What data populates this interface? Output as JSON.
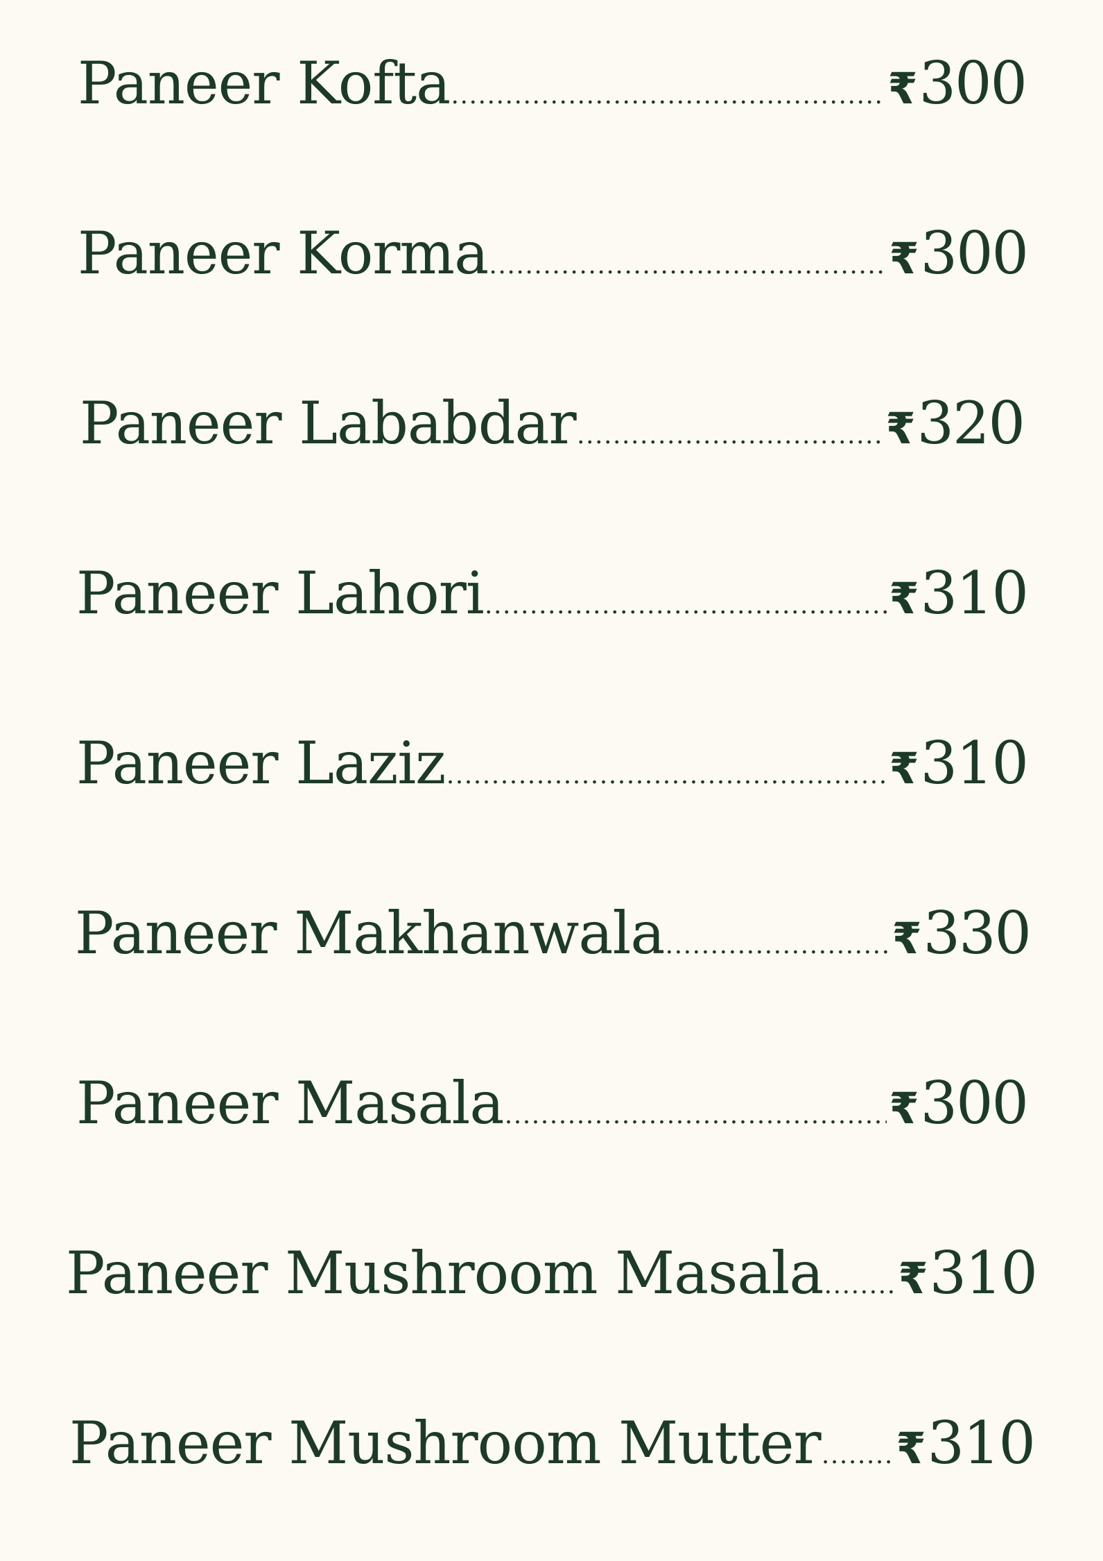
{
  "currency_symbol": "₹",
  "colors": {
    "background": "#fdf9f3",
    "text": "#1c3a28"
  },
  "menu": {
    "items": [
      {
        "name": "Paneer Kofta",
        "price": "300"
      },
      {
        "name": "Paneer Korma",
        "price": "300"
      },
      {
        "name": "Paneer Lababdar",
        "price": "320"
      },
      {
        "name": "Paneer Lahori",
        "price": "310"
      },
      {
        "name": "Paneer Laziz",
        "price": "310"
      },
      {
        "name": "Paneer Makhanwala",
        "price": "330"
      },
      {
        "name": "Paneer Masala",
        "price": "300"
      },
      {
        "name": "Paneer Mushroom Masala",
        "price": "310"
      },
      {
        "name": "Paneer Mushroom Mutter",
        "price": "310"
      }
    ]
  }
}
